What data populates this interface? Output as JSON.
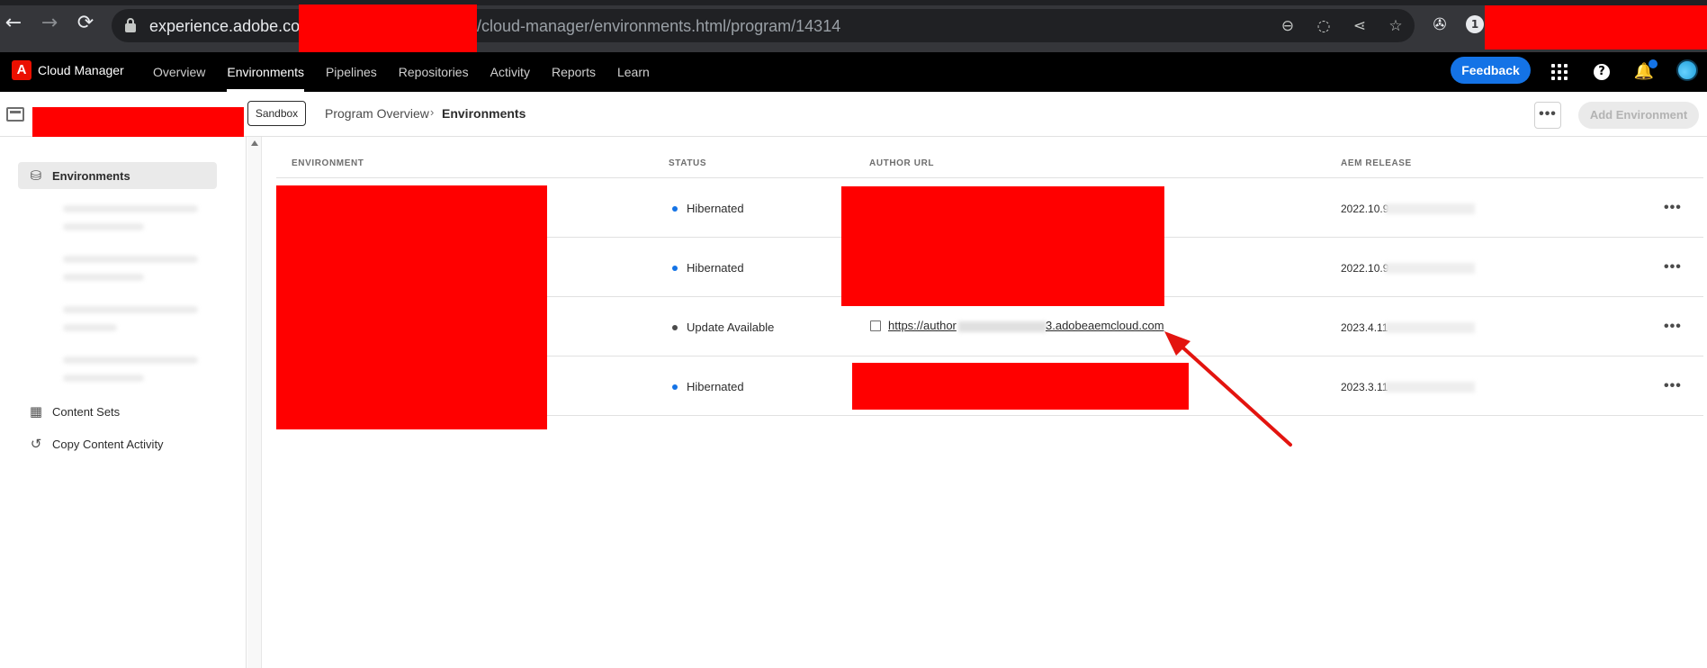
{
  "browser": {
    "url_host": "experience.adobe.co",
    "url_path": "/cloud-manager/environments.html/program/14314",
    "back_icon": "arrow-left-icon",
    "forward_icon": "arrow-right-icon",
    "reload_icon": "reload-icon",
    "omnibox_icons": [
      "zoom-icon",
      "eye-off-icon",
      "share-icon",
      "star-icon"
    ],
    "extension_icons": [
      "extension-icon",
      "password-manager-icon"
    ]
  },
  "app": {
    "logo_letter": "A",
    "brand": "Cloud Manager",
    "nav": [
      "Overview",
      "Environments",
      "Pipelines",
      "Repositories",
      "Activity",
      "Reports",
      "Learn"
    ],
    "active_nav": "Environments",
    "feedback_label": "Feedback",
    "accent_color": "#1473e6"
  },
  "subheader": {
    "sandbox_label": "Sandbox",
    "breadcrumb": [
      "Program Overview",
      "Environments"
    ],
    "more_label": "•••",
    "add_environment_label": "Add Environment"
  },
  "sidebar": {
    "items": [
      {
        "label": "Environments",
        "icon": "database-icon",
        "active": true
      },
      {
        "label": "Content Sets",
        "icon": "box-icon",
        "active": false
      },
      {
        "label": "Copy Content Activity",
        "icon": "history-icon",
        "active": false
      }
    ]
  },
  "table": {
    "headers": [
      "ENVIRONMENT",
      "STATUS",
      "AUTHOR URL",
      "AEM RELEASE"
    ],
    "rows": [
      {
        "status": "Hibernated",
        "status_color": "#1473e6",
        "release": "2022.10.9"
      },
      {
        "status": "Hibernated",
        "status_color": "#1473e6",
        "release": "2022.10.9"
      },
      {
        "status": "Update Available",
        "status_color": "#4b4b4b",
        "release": "2023.4.11",
        "author_url_prefix": "https://author",
        "author_url_suffix": "3.adobeaemcloud.com"
      },
      {
        "status": "Hibernated",
        "status_color": "#1473e6",
        "release": "2023.3.11"
      }
    ],
    "row_more_label": "•••"
  },
  "annotation": {
    "arrow_color": "#e3140f"
  }
}
